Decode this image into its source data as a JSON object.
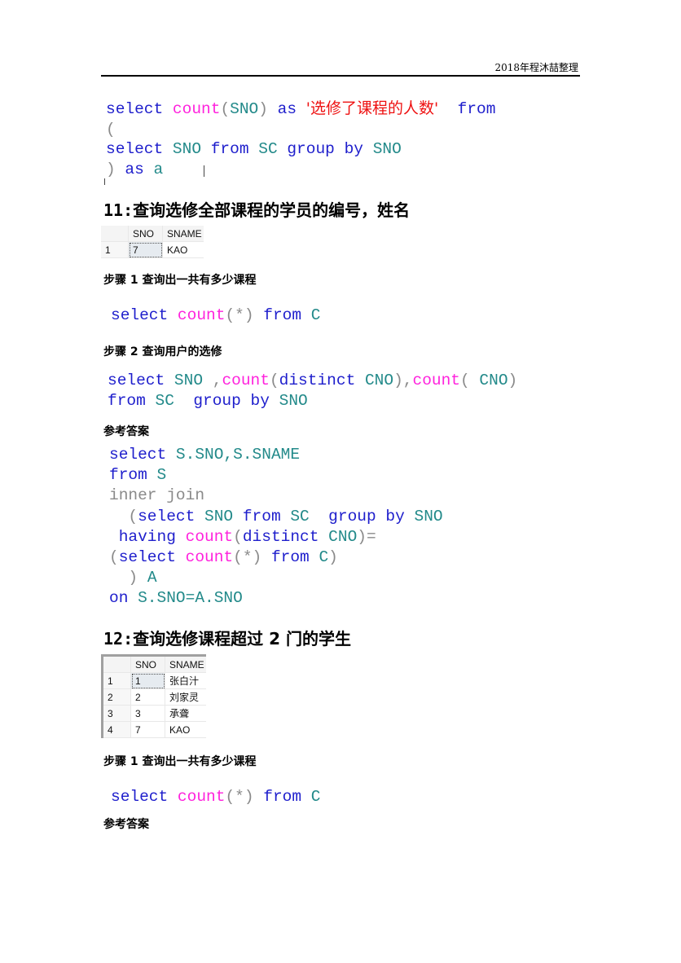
{
  "header": {
    "text": "2018年程沐喆整理"
  },
  "code1": {
    "line1": [
      "select",
      "count",
      "(",
      "SNO",
      ")",
      "as",
      "'选修了课程的人数'",
      "from"
    ],
    "line2": "(",
    "line3": [
      "select",
      "SNO",
      "from",
      "SC",
      "group by",
      "SNO"
    ],
    "line4": [
      ")",
      "as",
      "a"
    ]
  },
  "q11": {
    "title_num": "11:",
    "title_text": "查询选修全部课程的学员的编号，姓名",
    "table": {
      "columns": [
        "",
        "SNO",
        "SNAME"
      ],
      "rows": [
        [
          "1",
          "7",
          "KAO"
        ]
      ]
    },
    "step1": "步骤 1  查询出一共有多少课程",
    "step1_code": [
      "select",
      "count",
      "(*)",
      "from",
      "C"
    ],
    "step2": "步骤 2  查询用户的选修",
    "step2_code": {
      "line1": [
        "select",
        "SNO",
        ",",
        "count",
        "(",
        "distinct",
        "CNO",
        "),",
        "count",
        "(",
        "CNO",
        ")"
      ],
      "line2": [
        "from",
        "SC",
        "group by",
        "SNO"
      ]
    },
    "answer_label": "参考答案",
    "answer_code": {
      "l1": [
        "select",
        "S.SNO,S.SNAME"
      ],
      "l2": [
        "from",
        "S"
      ],
      "l3": "inner join",
      "l4": [
        "(",
        "select",
        "SNO",
        "from",
        "SC",
        "group by",
        "SNO"
      ],
      "l5": [
        "having",
        "count",
        "(",
        "distinct",
        "CNO",
        ")="
      ],
      "l6": [
        "(",
        "select",
        "count",
        "(*)",
        "from",
        "C",
        ")"
      ],
      "l7": [
        ")",
        "A"
      ],
      "l8": [
        "on",
        "S.SNO=A.SNO"
      ]
    }
  },
  "q12": {
    "title_num": "12:",
    "title_text": "查询选修课程超过 2 门的学生",
    "table": {
      "columns": [
        "",
        "SNO",
        "SNAME"
      ],
      "rows": [
        [
          "1",
          "1",
          "张白汁"
        ],
        [
          "2",
          "2",
          "刘家灵"
        ],
        [
          "3",
          "3",
          "承聋"
        ],
        [
          "4",
          "7",
          "KAO"
        ]
      ]
    },
    "step1": "步骤 1  查询出一共有多少课程",
    "step1_code": [
      "select",
      "count",
      "(*)",
      "from",
      "C"
    ],
    "answer_label": "参考答案"
  }
}
